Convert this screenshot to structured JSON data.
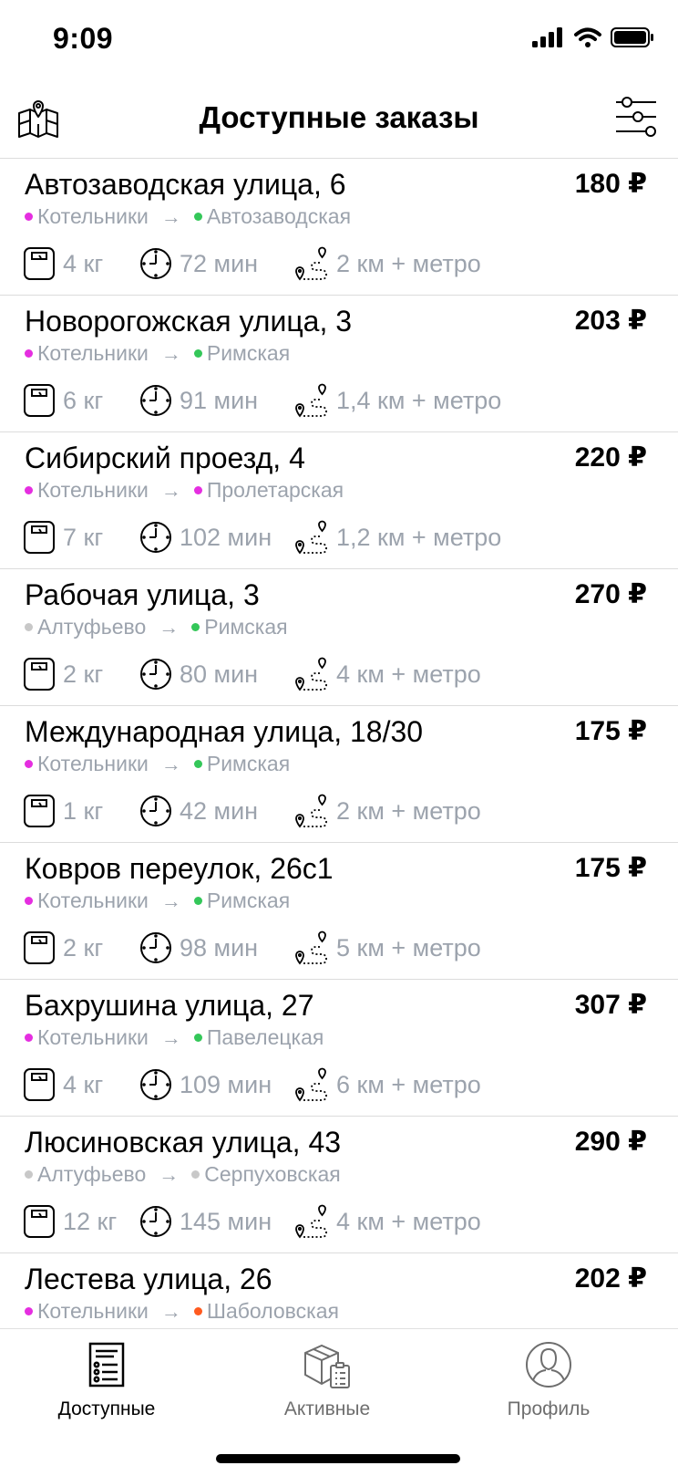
{
  "status_bar": {
    "time": "9:09"
  },
  "header": {
    "title": "Доступные заказы",
    "map_icon": "map-icon",
    "filter_icon": "filter-sliders-icon"
  },
  "colors": {
    "magenta": "#e52ee0",
    "green": "#34c759",
    "gray": "#c8c8c8",
    "orange": "#ff5a1f"
  },
  "orders": [
    {
      "address": "Автозаводская улица, 6",
      "price": "180 ₽",
      "from": "Котельники",
      "from_color": "#e52ee0",
      "to": "Автозаводская",
      "to_color": "#34c759",
      "weight": "4 кг",
      "time": "72 мин",
      "distance": "2 км + метро"
    },
    {
      "address": "Новорогожская улица, 3",
      "price": "203 ₽",
      "from": "Котельники",
      "from_color": "#e52ee0",
      "to": "Римская",
      "to_color": "#34c759",
      "weight": "6 кг",
      "time": "91 мин",
      "distance": "1,4 км + метро"
    },
    {
      "address": "Сибирский проезд, 4",
      "price": "220 ₽",
      "from": "Котельники",
      "from_color": "#e52ee0",
      "to": "Пролетарская",
      "to_color": "#e52ee0",
      "weight": "7 кг",
      "time": "102 мин",
      "distance": "1,2 км + метро"
    },
    {
      "address": "Рабочая улица, 3",
      "price": "270 ₽",
      "from": "Алтуфьево",
      "from_color": "#c8c8c8",
      "to": "Римская",
      "to_color": "#34c759",
      "weight": "2 кг",
      "time": "80 мин",
      "distance": "4 км + метро"
    },
    {
      "address": "Международная улица, 18/30",
      "price": "175 ₽",
      "from": "Котельники",
      "from_color": "#e52ee0",
      "to": "Римская",
      "to_color": "#34c759",
      "weight": "1 кг",
      "time": "42 мин",
      "distance": "2 км + метро"
    },
    {
      "address": "Ковров переулок, 26с1",
      "price": "175 ₽",
      "from": "Котельники",
      "from_color": "#e52ee0",
      "to": "Римская",
      "to_color": "#34c759",
      "weight": "2 кг",
      "time": "98 мин",
      "distance": "5 км + метро"
    },
    {
      "address": "Бахрушина улица, 27",
      "price": "307 ₽",
      "from": "Котельники",
      "from_color": "#e52ee0",
      "to": "Павелецкая",
      "to_color": "#34c759",
      "weight": "4 кг",
      "time": "109 мин",
      "distance": "6 км + метро"
    },
    {
      "address": "Люсиновская улица, 43",
      "price": "290 ₽",
      "from": "Алтуфьево",
      "from_color": "#c8c8c8",
      "to": "Серпуховская",
      "to_color": "#c8c8c8",
      "weight": "12 кг",
      "time": "145 мин",
      "distance": "4 км + метро"
    },
    {
      "address": "Лестева улица, 26",
      "price": "202 ₽",
      "from": "Котельники",
      "from_color": "#e52ee0",
      "to": "Шаболовская",
      "to_color": "#ff5a1f",
      "weight": "",
      "time": "",
      "distance": ""
    }
  ],
  "tabs": [
    {
      "label": "Доступные",
      "icon": "orders-list-icon",
      "active": true
    },
    {
      "label": "Активные",
      "icon": "package-icon",
      "active": false
    },
    {
      "label": "Профиль",
      "icon": "profile-icon",
      "active": false
    }
  ]
}
